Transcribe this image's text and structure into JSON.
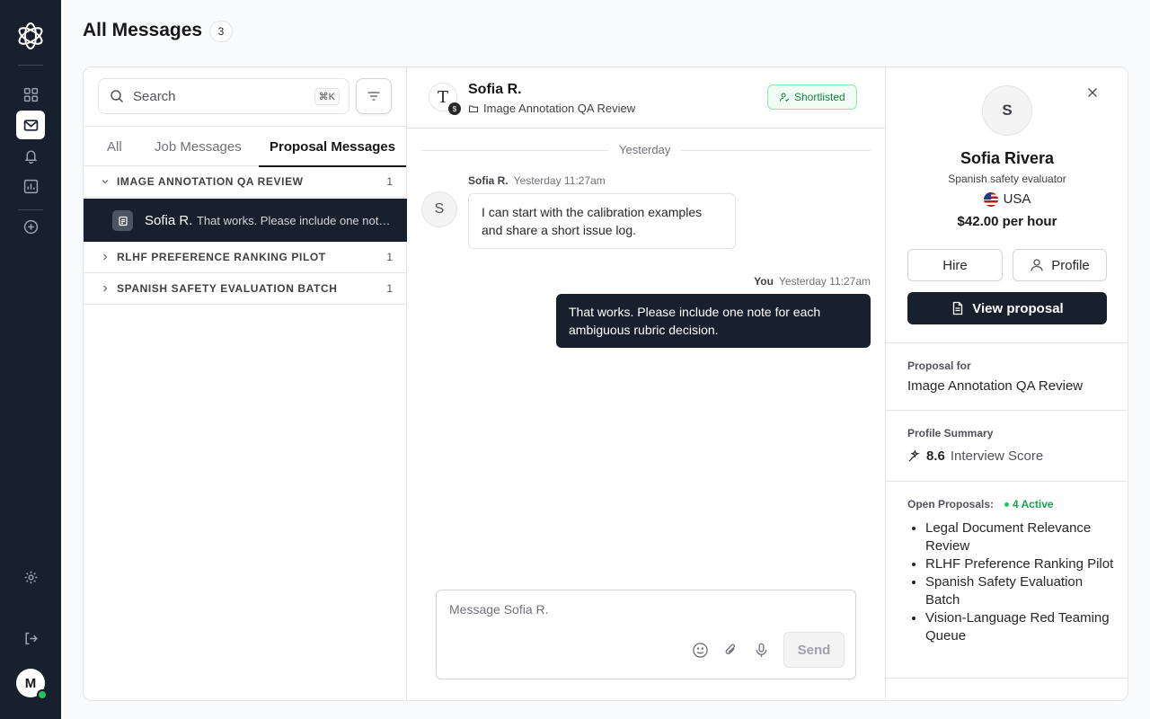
{
  "header": {
    "title": "All Messages",
    "count": "3"
  },
  "search": {
    "placeholder": "Search",
    "shortcut": "⌘K"
  },
  "tabs": [
    {
      "label": "All",
      "active": false
    },
    {
      "label": "Job Messages",
      "active": false
    },
    {
      "label": "Proposal Messages",
      "active": true
    }
  ],
  "groups": [
    {
      "name": "IMAGE ANNOTATION QA REVIEW",
      "count": "1",
      "expanded": true
    },
    {
      "name": "RLHF PREFERENCE RANKING PILOT",
      "count": "1",
      "expanded": false
    },
    {
      "name": "SPANISH SAFETY EVALUATION BATCH",
      "count": "1",
      "expanded": false
    }
  ],
  "thread": {
    "name": "Sofia R.",
    "preview": "That works. Please include one note for each ambiguous rubric decision."
  },
  "chat": {
    "avatar_letter": "T",
    "name": "Sofia R.",
    "job": "Image Annotation QA Review",
    "status": "Shortlisted",
    "day": "Yesterday",
    "messages": [
      {
        "avatar": "S",
        "sender": "Sofia R.",
        "time": "Yesterday 11:27am",
        "text": "I can start with the calibration examples and share a short issue log."
      },
      {
        "sender": "You",
        "time": "Yesterday 11:27am",
        "text": "That works. Please include one note for each ambiguous rubric decision."
      }
    ],
    "composer_placeholder": "Message Sofia R.",
    "send_label": "Send"
  },
  "profile": {
    "avatar_letter": "S",
    "name": "Sofia Rivera",
    "role": "Spanish safety evaluator",
    "country": "USA",
    "rate": "$42.00 per hour",
    "hire_label": "Hire",
    "profile_label": "Profile",
    "view_proposal_label": "View proposal",
    "proposal_for_label": "Proposal for",
    "proposal_for_value": "Image Annotation QA Review",
    "summary_label": "Profile Summary",
    "score_value": "8.6",
    "score_label": "Interview Score",
    "open_label": "Open Proposals:",
    "open_active": "4 Active",
    "open_list": [
      "Legal Document Relevance Review",
      "RLHF Preference Ranking Pilot",
      "Spanish Safety Evaluation Batch",
      "Vision-Language Red Teaming Queue"
    ]
  },
  "user": {
    "initial": "M",
    "online": true
  },
  "colors": {
    "primary": "#18202d",
    "success": "#16a34a",
    "border": "#e4e4e7"
  },
  "icons": [
    "app-logo-icon",
    "dashboard-icon",
    "mail-icon",
    "bell-icon",
    "chart-icon",
    "plus-circle-icon",
    "gear-icon",
    "logout-icon",
    "search-icon",
    "filter-icon",
    "chevron-down-icon",
    "chevron-right-icon",
    "proposal-icon",
    "folder-icon",
    "shortlist-user-icon",
    "smile-icon",
    "paperclip-icon",
    "mic-icon",
    "close-icon",
    "user-icon",
    "document-icon",
    "sparkle-icon"
  ]
}
